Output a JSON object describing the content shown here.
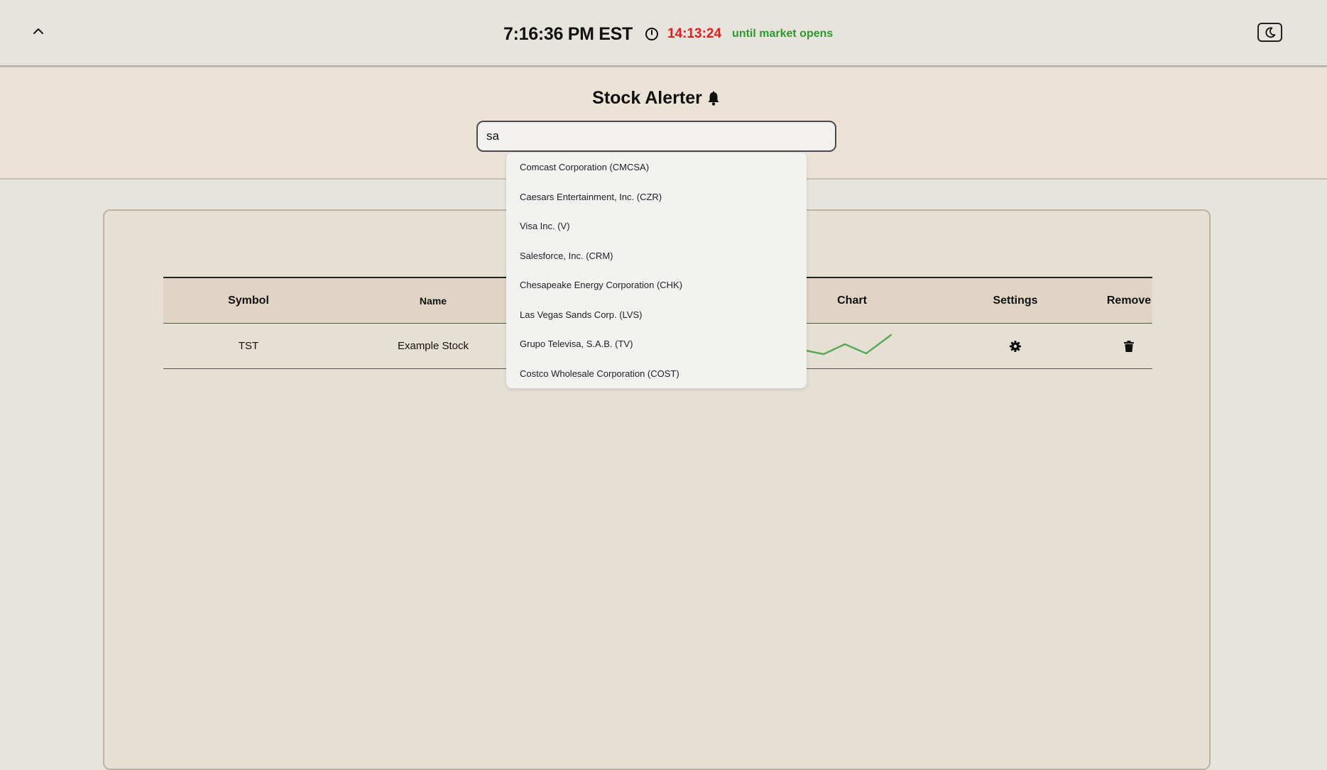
{
  "topbar": {
    "collapse_icon": "chevron-up-icon",
    "time": "7:16:36 PM EST",
    "clock_icon": "clock-icon",
    "countdown": "14:13:24",
    "market_status": "until market opens",
    "theme_icon": "moon-icon"
  },
  "header": {
    "title": "Stock Alerter",
    "title_icon": "bell-icon"
  },
  "search": {
    "value": "sa",
    "suggestions": [
      "Comcast Corporation (CMCSA)",
      "Caesars Entertainment, Inc. (CZR)",
      "Visa Inc. (V)",
      "Salesforce, Inc. (CRM)",
      "Chesapeake Energy Corporation (CHK)",
      "Las Vegas Sands Corp. (LVS)",
      "Grupo Televisa, S.A.B. (TV)",
      "Costco Wholesale Corporation (COST)"
    ]
  },
  "table": {
    "headers": {
      "symbol": "Symbol",
      "name": "Name",
      "chart": "Chart",
      "settings": "Settings",
      "remove": "Remove"
    },
    "rows": [
      {
        "symbol": "TST",
        "name": "Example Stock",
        "settings_icon": "gear-icon",
        "remove_icon": "trash-icon"
      }
    ]
  },
  "colors": {
    "countdown": "#e01e1e",
    "market_status": "#2e9a2e",
    "sparkline": "#5aaa5a"
  }
}
